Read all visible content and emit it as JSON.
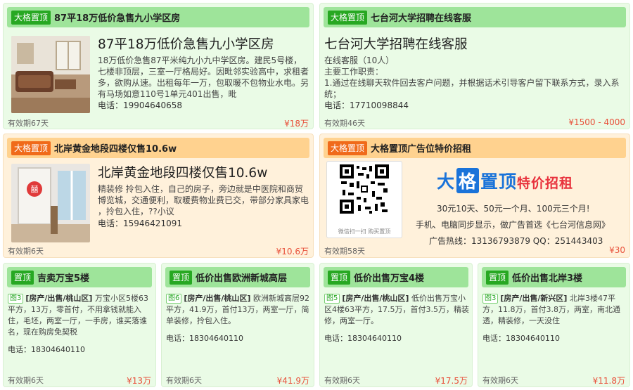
{
  "cards": {
    "c1": {
      "tag": "大格置顶",
      "head_title": "87平18万低价急售九小学区房",
      "big_title": "87平18万低价急售九小学区房",
      "desc": "18万低价急售87平米纯九小九中学区房。建民5号楼，七楼非顶层，三室一厅格局好。因毗邻实验高中，求租者多，欲购从速。出租每年一万，包取暖不包物业水电。另有马场如意110号1单元401出售，毗",
      "phone": "电话：19904640658",
      "validity": "有效期67天",
      "price": "¥18万"
    },
    "c2": {
      "tag": "大格置顶",
      "head_title": "七台河大学招聘在线客服",
      "big_title": "七台河大学招聘在线客服",
      "line1": "在线客服（10人）",
      "line2": "主要工作职责：",
      "line3": "1.通过在线聊天软件回去客户问题，并根据话术引导客户留下联系方式，录入系统；",
      "phone": "电话：17710098844",
      "validity": "有效期46天",
      "price": "¥1500 - 4000"
    },
    "c3": {
      "tag": "大格置顶",
      "head_title": "北岸黄金地段四楼仅售10.6w",
      "big_title": "北岸黄金地段四楼仅售10.6w",
      "desc": "精装修 拎包入住，自己的房子，旁边就是中医院和商贸博览城，交通便利，取暖费物业费已交，带部分家具家电 ，拎包入住，??小议",
      "phone": "电话：15946421091",
      "validity": "有效期6天",
      "price": "¥10.6万"
    },
    "c4": {
      "tag": "大格置顶",
      "head_title": "大格置顶广告位特价招租",
      "qr_caption": "微信扫一扫 购买置顶",
      "brand_a": "大",
      "brand_b": "格",
      "brand_c": "置顶",
      "brand_d": "特价招租",
      "line1": "30元10天、50元一个月、100元三个月!",
      "line2": "手机、电脑同步显示，做广告首选《七台河信息网》",
      "line3": "广告热线：13136793879  QQ：251443403",
      "validity": "有效期58天",
      "price": "¥30"
    },
    "c5": {
      "tag": "置顶",
      "head_title": "吉卖万宝5楼",
      "badge": "图3",
      "cat": "[房产/出售/桃山区]",
      "desc": "万宝小区5楼63平方，13万，零首付，不用拿钱就能入住，毛坯，两室一厅，一手房，谁买落谁名，现在购房免契税",
      "phone": "电话：18304640110",
      "validity": "有效期6天",
      "price": "¥13万"
    },
    "c6": {
      "tag": "置顶",
      "head_title": "低价出售欧洲新城高层",
      "badge": "图6",
      "cat": "[房产/出售/桃山区]",
      "desc": "欧洲新城高层92平方，41.9万，首付13万，两室一厅，简单装修，拎包入住。",
      "phone": "电话：18304640110",
      "validity": "有效期6天",
      "price": "¥41.9万"
    },
    "c7": {
      "tag": "置顶",
      "head_title": "低价出售万宝4楼",
      "badge": "图5",
      "cat": "[房产/出售/桃山区]",
      "desc": "低价出售万宝小区4楼63平方，17.5万，首付3.5万，精装修，两室一厅。",
      "phone": "电话：18304640110",
      "validity": "有效期6天",
      "price": "¥17.5万"
    },
    "c8": {
      "tag": "置顶",
      "head_title": "低价出售北岸3楼",
      "badge": "图3",
      "cat": "[房产/出售/新兴区]",
      "desc": "北岸3楼47平方，11.8万，首付3.8万，两室，南北通透，精装修，一天没住",
      "phone": "电话：18304640110",
      "validity": "有效期6天",
      "price": "¥11.8万"
    }
  },
  "colors": {
    "green_bg": "#eafbe6",
    "green_head": "#9ee49a",
    "green_tag": "#27a822",
    "orange_bg": "#fff1db",
    "orange_head": "#ffd28f",
    "orange_tag": "#f06a1a",
    "price": "#e8503a",
    "brand_blue": "#1a73d9",
    "brand_red": "#e8313c"
  }
}
